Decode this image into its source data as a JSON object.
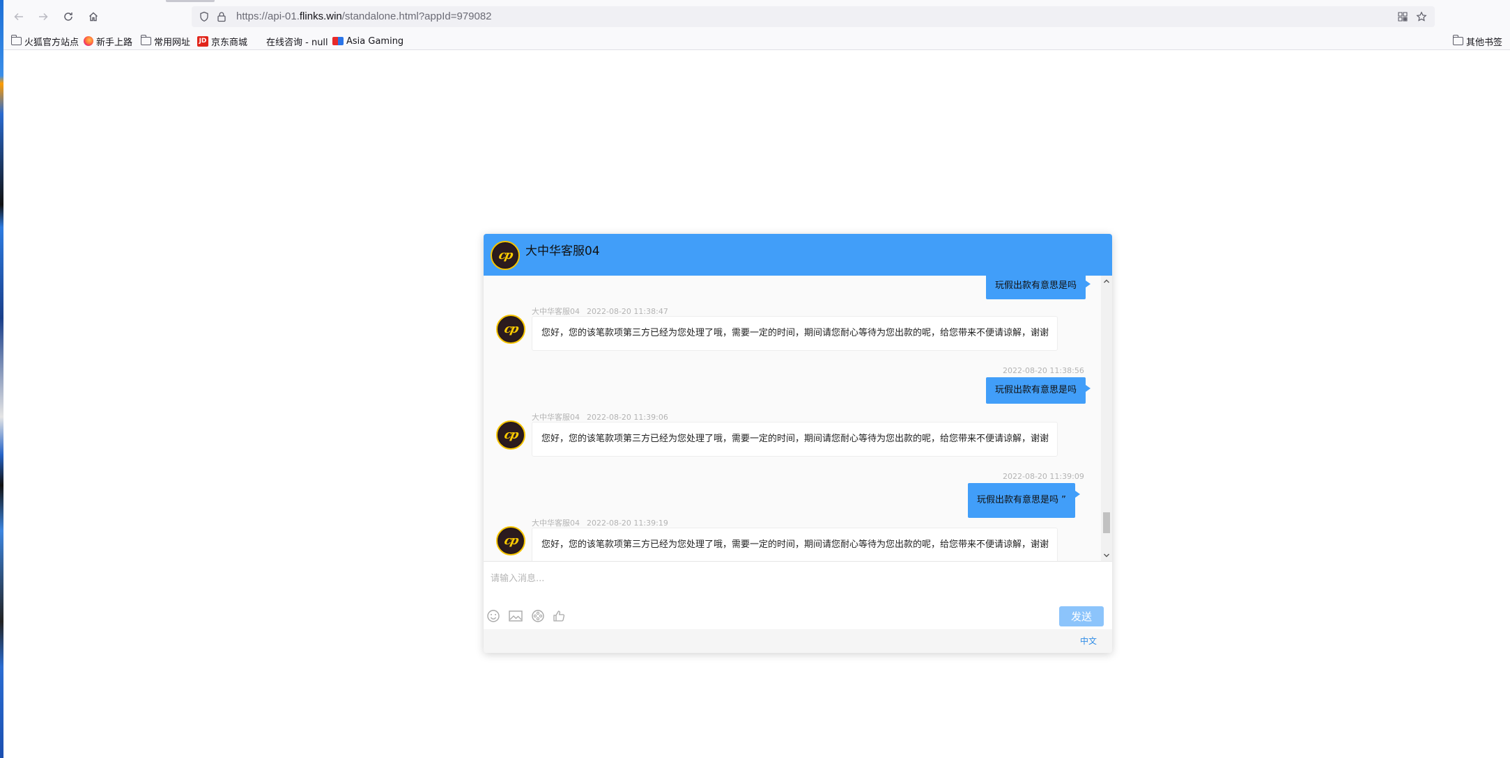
{
  "browser": {
    "url_prefix": "https://api-01.",
    "url_host": "flinks.win",
    "url_path": "/standalone.html?appId=979082",
    "bookmarks": [
      "火狐官方站点",
      "新手上路",
      "常用网址",
      "京东商城",
      "在线咨询 - null",
      "Asia Gaming"
    ],
    "other_bookmarks": "其他书签",
    "jd_icon_text": "JD"
  },
  "chat": {
    "title": "大中华客服04",
    "avatar_text": "cp",
    "messages": [
      {
        "type": "user",
        "text": "玩假出款有意思是吗"
      },
      {
        "type": "agent",
        "name": "大中华客服04",
        "time": "2022-08-20 11:38:47",
        "text": "您好，您的该笔款项第三方已经为您处理了哦，需要一定的时间，期间请您耐心等待为您出款的呢，给您带来不便请谅解，谢谢"
      },
      {
        "type": "user",
        "time": "2022-08-20 11:38:56",
        "text": "玩假出款有意思是吗"
      },
      {
        "type": "agent",
        "name": "大中华客服04",
        "time": "2022-08-20 11:39:06",
        "text": "您好，您的该笔款项第三方已经为您处理了哦，需要一定的时间，期间请您耐心等待为您出款的呢，给您带来不便请谅解，谢谢"
      },
      {
        "type": "user",
        "time": "2022-08-20 11:39:09",
        "text": "玩假出款有意思是吗 ”"
      },
      {
        "type": "agent",
        "name": "大中华客服04",
        "time": "2022-08-20 11:39:19",
        "text": "您好，您的该笔款项第三方已经为您处理了哦，需要一定的时间，期间请您耐心等待为您出款的呢，给您带来不便请谅解，谢谢"
      }
    ],
    "input_placeholder": "请输入消息...",
    "send_label": "发送",
    "language": "中文",
    "accent_color": "#419ef9"
  }
}
